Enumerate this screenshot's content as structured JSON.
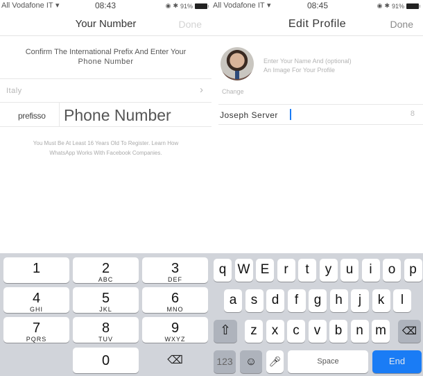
{
  "left": {
    "status": {
      "carrier": "All Vodafone IT",
      "time": "08:43",
      "battery": "91%"
    },
    "nav": {
      "title": "Your Number",
      "done": "Done"
    },
    "instructions_line1": "Confirm The International Prefix And Enter Your",
    "instructions_line2": "Phone Number",
    "country": "Italy",
    "prefix_label": "prefisso",
    "phone_placeholder": "Phone Number",
    "terms_line1": "You Must Be At Least 16 Years Old To Register. Learn How",
    "terms_line2": "WhatsApp Works With Facebook Companies.",
    "keypad": [
      {
        "n": "1",
        "l": ""
      },
      {
        "n": "2",
        "l": "ABC"
      },
      {
        "n": "3",
        "l": "DEF"
      },
      {
        "n": "4",
        "l": "GHI"
      },
      {
        "n": "5",
        "l": "JKL"
      },
      {
        "n": "6",
        "l": "MNO"
      },
      {
        "n": "7",
        "l": "PQRS"
      },
      {
        "n": "8",
        "l": "TUV"
      },
      {
        "n": "9",
        "l": "WXYZ"
      },
      {
        "n": "0",
        "l": ""
      }
    ]
  },
  "right": {
    "status": {
      "carrier": "All Vodafone IT",
      "time": "08:45",
      "battery": "91%"
    },
    "nav": {
      "title": "Edit Profile",
      "done": "Done"
    },
    "hint_line1": "Enter Your Name And (optional)",
    "hint_line2": "An Image For Your Profile",
    "change_label": "Change",
    "name_value": "Joseph Server",
    "char_count": "8",
    "keyboard": {
      "row1": [
        "q",
        "W",
        "E",
        "r",
        "t",
        "y",
        "u",
        "i",
        "o",
        "p"
      ],
      "row2": [
        "a",
        "s",
        "d",
        "f",
        "g",
        "h",
        "j",
        "k",
        "l"
      ],
      "row3": [
        "z",
        "x",
        "c",
        "v",
        "b",
        "n",
        "m"
      ],
      "numbers_label": "123",
      "space_label": "Space",
      "return_label": "End"
    }
  },
  "colors": {
    "accent": "#1a7cf5",
    "done_disabled": "#d3d3d3",
    "done_enabled": "#8a8a8a"
  }
}
